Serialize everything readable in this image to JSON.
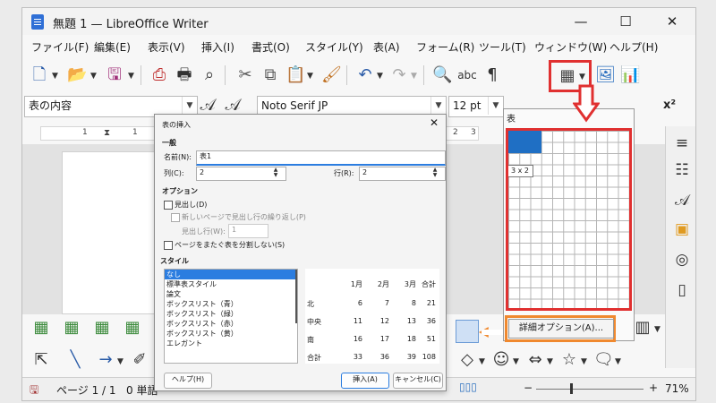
{
  "window": {
    "title": "無題 1 — LibreOffice Writer"
  },
  "menu": [
    "ファイル(F)",
    "編集(E)",
    "表示(V)",
    "挿入(I)",
    "書式(O)",
    "スタイル(Y)",
    "表(A)",
    "フォーム(R)",
    "ツール(T)",
    "ウィンドウ(W)",
    "ヘルプ(H)"
  ],
  "format_bar": {
    "paragraph_style": "表の内容",
    "font_name": "Noto Serif JP",
    "font_size": "12 pt",
    "superscript": "x²"
  },
  "ruler_marks": [
    "1",
    "1",
    "2",
    "3"
  ],
  "dialog": {
    "title": "表の挿入",
    "general_heading": "一般",
    "name_label": "名前(N):",
    "name_value": "表1",
    "columns_label": "列(C):",
    "columns_value": "2",
    "rows_label": "行(R):",
    "rows_value": "2",
    "options_heading": "オプション",
    "heading_label": "見出し(D)",
    "repeat_label": "新しいページで見出し行の繰り返し(P)",
    "heading_rows_label": "見出し行(W):",
    "heading_rows_value": "1",
    "no_split_label": "ページをまたぐ表を分割しない(S)",
    "styles_heading": "スタイル",
    "styles": [
      "なし",
      "標準表スタイル",
      "論文",
      "ボックスリスト（青）",
      "ボックスリスト（緑）",
      "ボックスリスト（赤）",
      "ボックスリスト（黄）",
      "エレガント"
    ],
    "preview": {
      "header": [
        "1月",
        "2月",
        "3月",
        "合計"
      ],
      "rows": [
        {
          "label": "北",
          "values": [
            "6",
            "7",
            "8",
            "21"
          ]
        },
        {
          "label": "中央",
          "values": [
            "11",
            "12",
            "13",
            "36"
          ]
        },
        {
          "label": "南",
          "values": [
            "16",
            "17",
            "18",
            "51"
          ]
        },
        {
          "label": "合計",
          "values": [
            "33",
            "36",
            "39",
            "108"
          ]
        }
      ]
    },
    "help_button": "ヘルプ(H)",
    "insert_button": "挿入(A)",
    "cancel_button": "キャンセル(C)"
  },
  "table_popup": {
    "heading": "表",
    "size_label": "3 x 2",
    "more_options": "詳細オプション(A)..."
  },
  "status": {
    "page": "ページ 1 / 1",
    "words": "0 単語",
    "zoom": "71%"
  },
  "colors": {
    "annotation_red": "#e03030",
    "annotation_orange": "#f0892f",
    "grid_highlight": "#1f6fc4"
  }
}
